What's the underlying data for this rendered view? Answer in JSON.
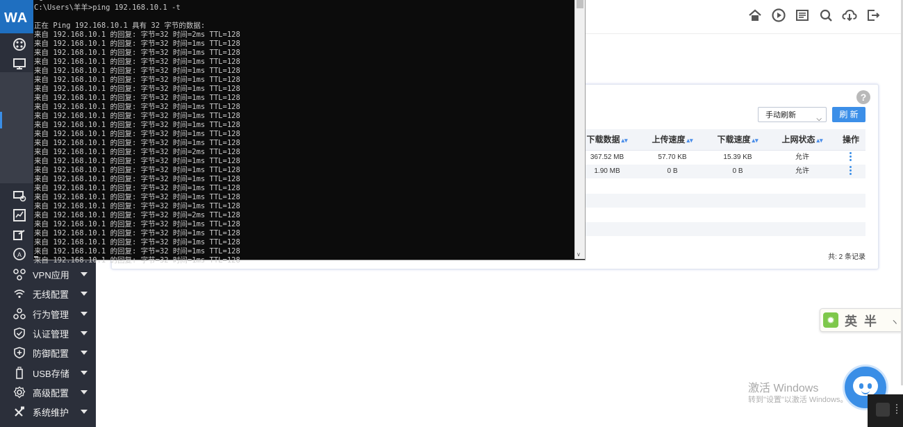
{
  "sidebar": {
    "logo": "WA",
    "menu": [
      {
        "label": "VPN应用",
        "icon": "network-icon"
      },
      {
        "label": "无线配置",
        "icon": "wifi-icon"
      },
      {
        "label": "行为管理",
        "icon": "users-icon"
      },
      {
        "label": "认证管理",
        "icon": "shield-check-icon"
      },
      {
        "label": "防御配置",
        "icon": "shield-plus-icon"
      },
      {
        "label": "USB存储",
        "icon": "usb-icon"
      },
      {
        "label": "高级配置",
        "icon": "gear-icon"
      },
      {
        "label": "系统维护",
        "icon": "tools-icon"
      }
    ]
  },
  "topbar": {
    "icons": [
      "home-icon",
      "play-circle-icon",
      "document-icon",
      "search-icon",
      "download-cloud-icon",
      "logout-icon"
    ]
  },
  "panel": {
    "help": "?",
    "refresh_mode": "手动刷新",
    "refresh_button": "刷 新",
    "columns": [
      "下载数据",
      "上传速度",
      "下载速度",
      "上网状态",
      "操作"
    ],
    "rows": [
      {
        "download_data": "367.52 MB",
        "upload_speed": "57.70 KB",
        "download_speed": "15.39 KB",
        "status": "允许"
      },
      {
        "download_data": "1.90 MB",
        "upload_speed": "0 B",
        "download_speed": "0 B",
        "status": "允许"
      }
    ],
    "records": "共: 2 条记录"
  },
  "terminal": {
    "text": "^C\nC:\\Users\\羊羊>ping 192.168.10.1 -t\n\n正在 Ping 192.168.10.1 具有 32 字节的数据:\n来自 192.168.10.1 的回复: 字节=32 时间=2ms TTL=128\n来自 192.168.10.1 的回复: 字节=32 时间=1ms TTL=128\n来自 192.168.10.1 的回复: 字节=32 时间=1ms TTL=128\n来自 192.168.10.1 的回复: 字节=32 时间=1ms TTL=128\n来自 192.168.10.1 的回复: 字节=32 时间=1ms TTL=128\n来自 192.168.10.1 的回复: 字节=32 时间=1ms TTL=128\n来自 192.168.10.1 的回复: 字节=32 时间=1ms TTL=128\n来自 192.168.10.1 的回复: 字节=32 时间=1ms TTL=128\n来自 192.168.10.1 的回复: 字节=32 时间=1ms TTL=128\n来自 192.168.10.1 的回复: 字节=32 时间=1ms TTL=128\n来自 192.168.10.1 的回复: 字节=32 时间=1ms TTL=128\n来自 192.168.10.1 的回复: 字节=32 时间=1ms TTL=128\n来自 192.168.10.1 的回复: 字节=32 时间=1ms TTL=128\n来自 192.168.10.1 的回复: 字节=32 时间=2ms TTL=128\n来自 192.168.10.1 的回复: 字节=32 时间=1ms TTL=128\n来自 192.168.10.1 的回复: 字节=32 时间=1ms TTL=128\n来自 192.168.10.1 的回复: 字节=32 时间=1ms TTL=128\n来自 192.168.10.1 的回复: 字节=32 时间=1ms TTL=128\n来自 192.168.10.1 的回复: 字节=32 时间=1ms TTL=128\n来自 192.168.10.1 的回复: 字节=32 时间=1ms TTL=128\n来自 192.168.10.1 的回复: 字节=32 时间=2ms TTL=128\n来自 192.168.10.1 的回复: 字节=32 时间=1ms TTL=128\n来自 192.168.10.1 的回复: 字节=32 时间=1ms TTL=128\n来自 192.168.10.1 的回复: 字节=32 时间=1ms TTL=128\n来自 192.168.10.1 的回复: 字节=32 时间=1ms TTL=128\n来自 192.168.10.1 的回复: 字节=32 时间=1ms TTL=128"
  },
  "ime": {
    "text": "英半",
    "mark": "ヽ"
  },
  "watermark": {
    "title": "激活 Windows",
    "subtitle": "转到\"设置\"以激活 Windows。"
  }
}
